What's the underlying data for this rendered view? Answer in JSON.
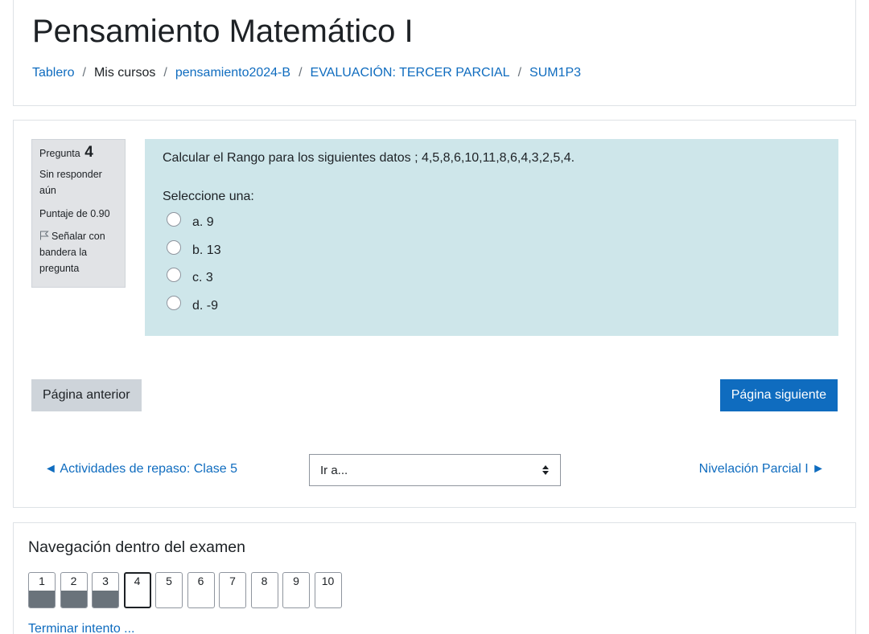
{
  "header": {
    "title": "Pensamiento Matemático I",
    "breadcrumb": [
      {
        "label": "Tablero",
        "link": true
      },
      {
        "label": "Mis cursos",
        "link": false
      },
      {
        "label": "pensamiento2024-B",
        "link": true
      },
      {
        "label": "EVALUACIÓN: TERCER PARCIAL",
        "link": true
      },
      {
        "label": "SUM1P3",
        "link": true
      }
    ],
    "separator": "/"
  },
  "question": {
    "label": "Pregunta",
    "number": "4",
    "state": "Sin responder aún",
    "grade": "Puntaje de 0.90",
    "flag_label": "Señalar con bandera la pregunta",
    "flag_icon": "flag-outline-icon",
    "text": "Calcular el Rango para los siguientes  datos ; 4,5,8,6,10,11,8,6,4,3,2,5,4.",
    "prompt": "Seleccione una:",
    "answers": [
      {
        "label": "a. 9",
        "selected": false
      },
      {
        "label": "b. 13",
        "selected": false
      },
      {
        "label": "c. 3",
        "selected": false
      },
      {
        "label": "d. -9",
        "selected": false
      }
    ]
  },
  "buttons": {
    "previous_page": "Página anterior",
    "next_page": "Página siguiente"
  },
  "activity_nav": {
    "previous": "◄ Actividades de repaso: Clase 5",
    "jump_placeholder": "Ir a...",
    "next": "Nivelación Parcial I ►"
  },
  "quiz_nav": {
    "title": "Navegación dentro del examen",
    "questions": [
      {
        "label": "1",
        "state": "answered"
      },
      {
        "label": "2",
        "state": "answered"
      },
      {
        "label": "3",
        "state": "answered"
      },
      {
        "label": "4",
        "state": "current"
      },
      {
        "label": "5",
        "state": "unanswered"
      },
      {
        "label": "6",
        "state": "unanswered"
      },
      {
        "label": "7",
        "state": "unanswered"
      },
      {
        "label": "8",
        "state": "unanswered"
      },
      {
        "label": "9",
        "state": "unanswered"
      },
      {
        "label": "10",
        "state": "unanswered"
      }
    ],
    "finish_link": "Terminar intento ..."
  },
  "colors": {
    "link": "#0f6cbf",
    "primary_button": "#0f6cbf",
    "question_bg": "#cee6ea",
    "info_bg": "#e1e3e6",
    "answered_fill": "#6a737b"
  }
}
